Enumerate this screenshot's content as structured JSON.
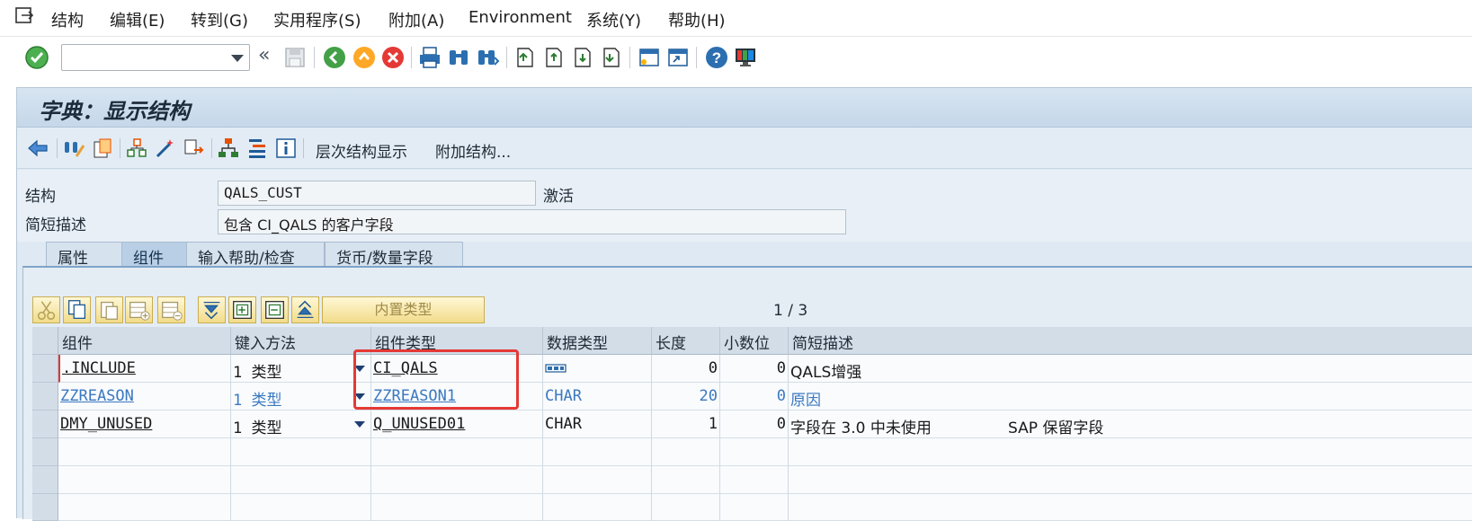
{
  "menu": {
    "items": [
      "结构",
      "编辑(E)",
      "转到(G)",
      "实用程序(S)",
      "附加(A)",
      "Environment",
      "系统(Y)",
      "帮助(H)"
    ]
  },
  "toolbar": {
    "command_value": "",
    "icons": [
      "check-icon",
      "command-dropdown-icon",
      "collapse-icon",
      "save-icon",
      "back-icon",
      "exit-icon",
      "cancel-icon",
      "print-icon",
      "find-icon",
      "find-next-icon",
      "first-page-icon",
      "prev-page-icon",
      "next-page-icon",
      "last-page-icon",
      "new-session-icon",
      "shortcut-icon",
      "help-icon",
      "customize-layout-icon"
    ]
  },
  "window": {
    "title": "字典：显示结构"
  },
  "app_toolbar": {
    "hierarchy_label": "层次结构显示",
    "append_label": "附加结构..."
  },
  "header": {
    "structure_label": "结构",
    "structure_value": "QALS_CUST",
    "status": "激活",
    "desc_label": "简短描述",
    "desc_value": "包含 CI_QALS 的客户字段"
  },
  "tabs": [
    "属性",
    "组件",
    "输入帮助/检查",
    "货币/数量字段"
  ],
  "active_tab": "组件",
  "table_toolbar": {
    "builtin_type_label": "内置类型",
    "pager": "1 / 3"
  },
  "table": {
    "columns": [
      "组件",
      "键入方法",
      "组件类型",
      "数据类型",
      "长度",
      "小数位",
      "简短描述"
    ],
    "rows": [
      {
        "component": ".INCLUDE",
        "method": "1 类型",
        "comp_type": "CI_QALS",
        "data_type": "",
        "length": "0",
        "decimals": "0",
        "desc": "QALS增强",
        "desc2": ""
      },
      {
        "component": "ZZREASON",
        "method": "1 类型",
        "comp_type": "ZZREASON1",
        "data_type": "CHAR",
        "length": "20",
        "decimals": "0",
        "desc": "原因",
        "desc2": ""
      },
      {
        "component": "DMY_UNUSED",
        "method": "1 类型",
        "comp_type": "Q_UNUSED01",
        "data_type": "CHAR",
        "length": "1",
        "decimals": "0",
        "desc": "字段在 3.0 中未使用",
        "desc2": "SAP 保留字段"
      }
    ]
  },
  "colors": {
    "highlight": "#e53935",
    "link_row": "#3a78c0",
    "header_bg": "#d3dde8"
  }
}
